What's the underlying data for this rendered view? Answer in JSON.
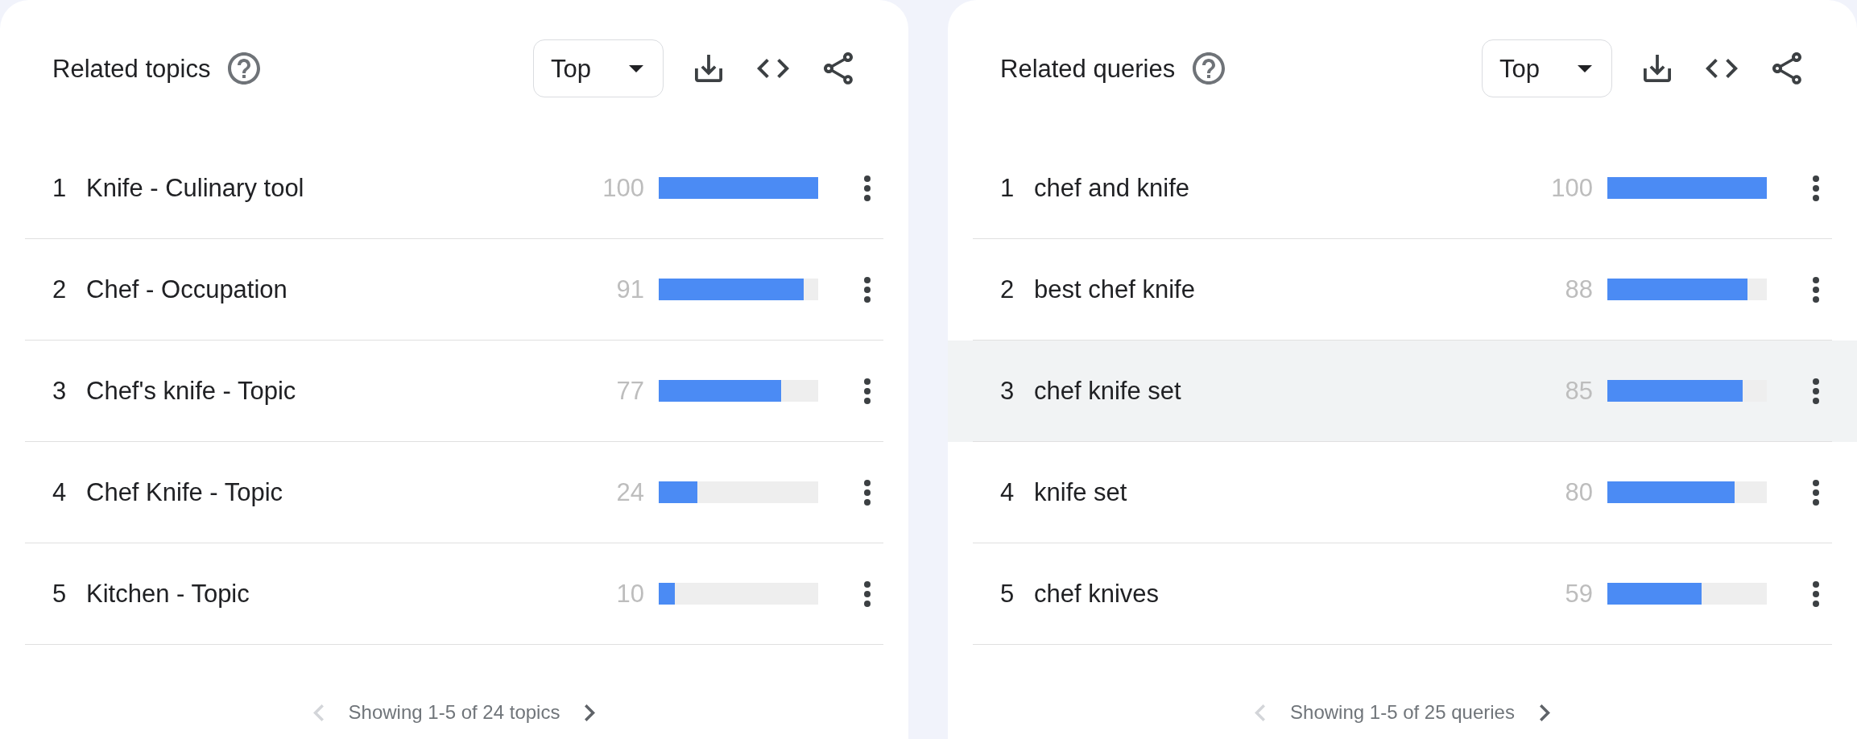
{
  "panels": [
    {
      "title": "Related topics",
      "dropdown": {
        "value": "Top"
      },
      "rows": [
        {
          "rank": "1",
          "label": "Knife - Culinary tool",
          "value": "100",
          "level": 1,
          "highlighted": false
        },
        {
          "rank": "2",
          "label": "Chef - Occupation",
          "value": "91",
          "level": 0.91,
          "highlighted": false
        },
        {
          "rank": "3",
          "label": "Chef's knife - Topic",
          "value": "77",
          "level": 0.77,
          "highlighted": false
        },
        {
          "rank": "4",
          "label": "Chef Knife - Topic",
          "value": "24",
          "level": 0.24,
          "highlighted": false
        },
        {
          "rank": "5",
          "label": "Kitchen - Topic",
          "value": "10",
          "level": 0.1,
          "highlighted": false
        }
      ],
      "pagination": {
        "text": "Showing 1-5 of 24 topics",
        "prev": {
          "disabled": true
        },
        "next": {
          "disabled": false
        }
      }
    },
    {
      "title": "Related queries",
      "dropdown": {
        "value": "Top"
      },
      "rows": [
        {
          "rank": "1",
          "label": "chef and knife",
          "value": "100",
          "level": 1,
          "highlighted": false
        },
        {
          "rank": "2",
          "label": "best chef knife",
          "value": "88",
          "level": 0.88,
          "highlighted": false
        },
        {
          "rank": "3",
          "label": "chef knife set",
          "value": "85",
          "level": 0.85,
          "highlighted": true
        },
        {
          "rank": "4",
          "label": "knife set",
          "value": "80",
          "level": 0.8,
          "highlighted": false
        },
        {
          "rank": "5",
          "label": "chef knives",
          "value": "59",
          "level": 0.59,
          "highlighted": false
        }
      ],
      "pagination": {
        "text": "Showing 1-5 of 25 queries",
        "prev": {
          "disabled": true
        },
        "next": {
          "disabled": false
        }
      }
    }
  ]
}
